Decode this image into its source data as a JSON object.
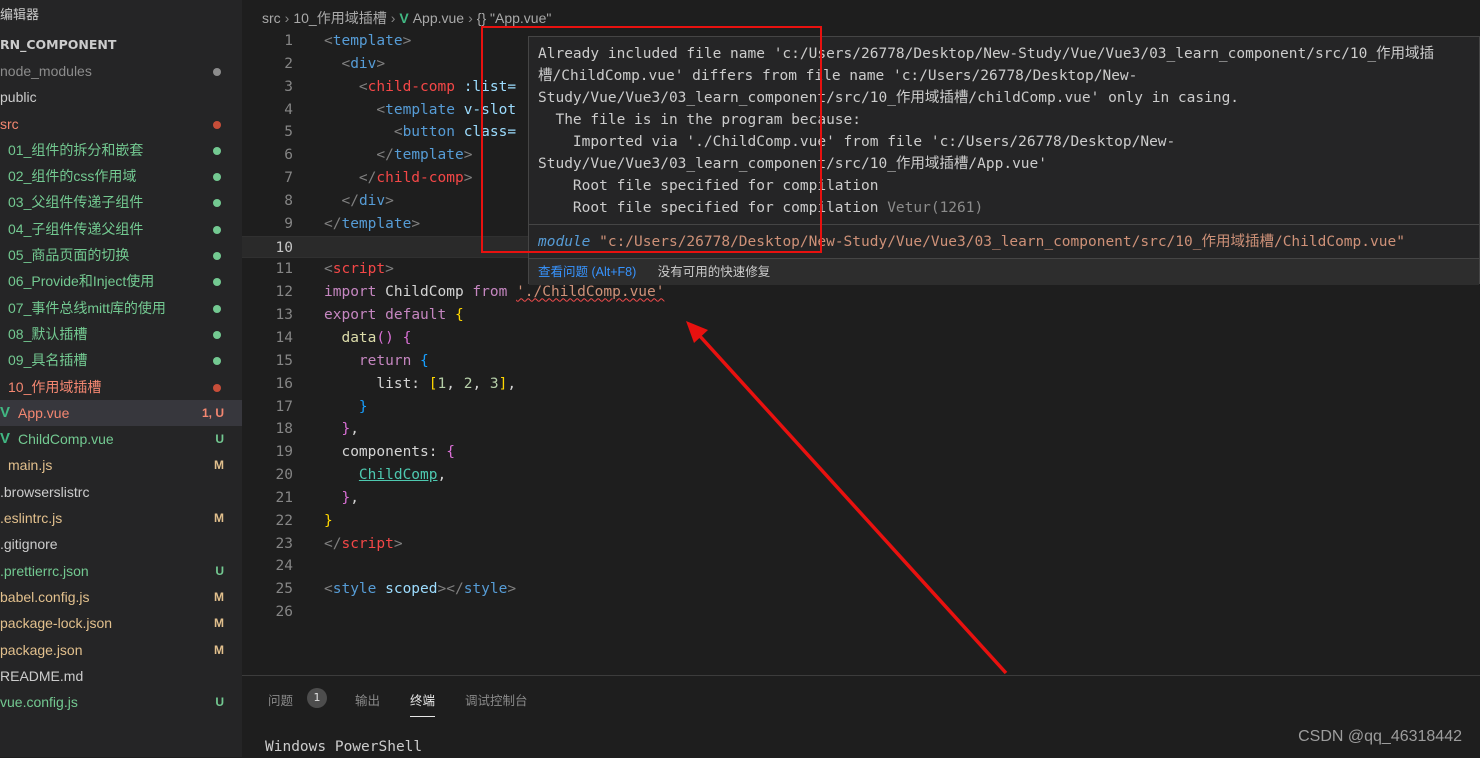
{
  "sidebar": {
    "title": "编辑器",
    "project": "RN_COMPONENT",
    "items": [
      {
        "label": "node_modules",
        "color": "gray",
        "dot": "gray"
      },
      {
        "label": "public",
        "color": "white"
      },
      {
        "label": "src",
        "color": "red",
        "dot": "red"
      },
      {
        "label": "01_组件的拆分和嵌套",
        "color": "green",
        "dot": "green"
      },
      {
        "label": "02_组件的css作用域",
        "color": "green",
        "dot": "green"
      },
      {
        "label": "03_父组件传递子组件",
        "color": "green",
        "dot": "green"
      },
      {
        "label": "04_子组件传递父组件",
        "color": "green",
        "dot": "green"
      },
      {
        "label": "05_商品页面的切换",
        "color": "green",
        "dot": "green"
      },
      {
        "label": "06_Provide和Inject使用",
        "color": "green",
        "dot": "green"
      },
      {
        "label": "07_事件总线mitt库的使用",
        "color": "green",
        "dot": "green"
      },
      {
        "label": "08_默认插槽",
        "color": "green",
        "dot": "green"
      },
      {
        "label": "09_具名插槽",
        "color": "green",
        "dot": "green"
      },
      {
        "label": "10_作用域插槽",
        "color": "red",
        "dot": "red"
      },
      {
        "label": "App.vue",
        "color": "red",
        "badge": "1, U",
        "icon": "vue-icon",
        "active": true
      },
      {
        "label": "ChildComp.vue",
        "color": "green",
        "badge": "U",
        "icon": "vue-icon"
      },
      {
        "label": "main.js",
        "color": "yellow",
        "badge": "M"
      },
      {
        "label": ".browserslistrc",
        "color": "white"
      },
      {
        "label": ".eslintrc.js",
        "color": "yellow",
        "badge": "M"
      },
      {
        "label": ".gitignore",
        "color": "white"
      },
      {
        "label": ".prettierrc.json",
        "color": "green",
        "badge": "U"
      },
      {
        "label": "babel.config.js",
        "color": "yellow",
        "badge": "M"
      },
      {
        "label": "package-lock.json",
        "color": "yellow",
        "badge": "M"
      },
      {
        "label": "package.json",
        "color": "yellow",
        "badge": "M"
      },
      {
        "label": "README.md",
        "color": "white"
      },
      {
        "label": "vue.config.js",
        "color": "green",
        "badge": "U"
      }
    ]
  },
  "breadcrumb": {
    "src": "src",
    "folder": "10_作用域插槽",
    "file": "App.vue",
    "symbol": "{} \"App.vue\""
  },
  "editor": {
    "current_line": 10,
    "lines": [
      [
        [
          "<",
          "t-br"
        ],
        [
          "template",
          "t-tag"
        ],
        [
          ">",
          "t-br"
        ]
      ],
      [
        [
          "  ",
          "t-pl"
        ],
        [
          "<",
          "t-br"
        ],
        [
          "div",
          "t-tag"
        ],
        [
          ">",
          "t-br"
        ]
      ],
      [
        [
          "    ",
          "t-pl"
        ],
        [
          "<",
          "t-br"
        ],
        [
          "child-comp",
          "t-tagred"
        ],
        [
          " :list=",
          "t-id"
        ]
      ],
      [
        [
          "      ",
          "t-pl"
        ],
        [
          "<",
          "t-br"
        ],
        [
          "template",
          "t-tag"
        ],
        [
          " v-slot",
          "t-id"
        ]
      ],
      [
        [
          "        ",
          "t-pl"
        ],
        [
          "<",
          "t-br"
        ],
        [
          "button",
          "t-tag"
        ],
        [
          " class=",
          "t-id"
        ]
      ],
      [
        [
          "      ",
          "t-pl"
        ],
        [
          "</",
          "t-br"
        ],
        [
          "template",
          "t-tag"
        ],
        [
          ">",
          "t-br"
        ]
      ],
      [
        [
          "    ",
          "t-pl"
        ],
        [
          "</",
          "t-br"
        ],
        [
          "child-comp",
          "t-tagred"
        ],
        [
          ">",
          "t-br"
        ]
      ],
      [
        [
          "  ",
          "t-pl"
        ],
        [
          "</",
          "t-br"
        ],
        [
          "div",
          "t-tag"
        ],
        [
          ">",
          "t-br"
        ]
      ],
      [
        [
          "</",
          "t-br"
        ],
        [
          "template",
          "t-tag"
        ],
        [
          ">",
          "t-br"
        ]
      ],
      [],
      [
        [
          "<",
          "t-br"
        ],
        [
          "script",
          "t-tagred"
        ],
        [
          ">",
          "t-br"
        ]
      ],
      [
        [
          "import",
          "t-kw"
        ],
        [
          " ChildComp ",
          "t-pl"
        ],
        [
          "from",
          "t-kw"
        ],
        [
          " ",
          "t-pl"
        ],
        [
          "'./ChildComp.vue'",
          "t-str squiggle"
        ]
      ],
      [
        [
          "export",
          "t-kw"
        ],
        [
          " ",
          "t-pl"
        ],
        [
          "default",
          "t-kw"
        ],
        [
          " ",
          "t-pl"
        ],
        [
          "{",
          "t-y"
        ]
      ],
      [
        [
          "  ",
          "t-pl"
        ],
        [
          "data",
          "t-fn"
        ],
        [
          "()",
          "t-m"
        ],
        [
          " ",
          "t-pl"
        ],
        [
          "{",
          "t-m"
        ]
      ],
      [
        [
          "    ",
          "t-pl"
        ],
        [
          "return",
          "t-kw"
        ],
        [
          " ",
          "t-pl"
        ],
        [
          "{",
          "t-cy"
        ]
      ],
      [
        [
          "      list: ",
          "t-pl"
        ],
        [
          "[",
          "t-y"
        ],
        [
          "1",
          "t-num"
        ],
        [
          ", ",
          "t-pl"
        ],
        [
          "2",
          "t-num"
        ],
        [
          ", ",
          "t-pl"
        ],
        [
          "3",
          "t-num"
        ],
        [
          "]",
          "t-y"
        ],
        [
          ",",
          "t-pl"
        ]
      ],
      [
        [
          "    ",
          "t-pl"
        ],
        [
          "}",
          "t-cy"
        ]
      ],
      [
        [
          "  ",
          "t-pl"
        ],
        [
          "}",
          "t-m"
        ],
        [
          ",",
          "t-pl"
        ]
      ],
      [
        [
          "  components: ",
          "t-pl"
        ],
        [
          "{",
          "t-m"
        ]
      ],
      [
        [
          "    ",
          "t-pl"
        ],
        [
          "ChildComp",
          "t-comp"
        ],
        [
          ",",
          "t-pl"
        ]
      ],
      [
        [
          "  ",
          "t-pl"
        ],
        [
          "}",
          "t-m"
        ],
        [
          ",",
          "t-pl"
        ]
      ],
      [
        [
          "}",
          "t-y"
        ]
      ],
      [
        [
          "</",
          "t-br"
        ],
        [
          "script",
          "t-tagred"
        ],
        [
          ">",
          "t-br"
        ]
      ],
      [],
      [
        [
          "<",
          "t-br"
        ],
        [
          "style",
          "t-tag"
        ],
        [
          " scoped",
          "t-id"
        ],
        [
          "></",
          "t-br"
        ],
        [
          "style",
          "t-tag"
        ],
        [
          ">",
          "t-br"
        ]
      ],
      []
    ]
  },
  "hover": {
    "message_lines": [
      "Already included file name 'c:/Users/26778/Desktop/New-Study/Vue/Vue3/03_learn_component/src/10_作用域插",
      "槽/ChildComp.vue' differs from file name 'c:/Users/26778/Desktop/New-",
      "Study/Vue/Vue3/03_learn_component/src/10_作用域插槽/childComp.vue' only in casing.",
      "  The file is in the program because:",
      "    Imported via './ChildComp.vue' from file 'c:/Users/26778/Desktop/New-",
      "Study/Vue/Vue3/03_learn_component/src/10_作用域插槽/App.vue'",
      "    Root file specified for compilation",
      "    Root file specified for compilation "
    ],
    "source": "Vetur(1261)",
    "module_keyword": "module",
    "module_path": " \"c:/Users/26778/Desktop/New-Study/Vue/Vue3/03_learn_component/src/10_作用域插槽/ChildComp.vue\"",
    "view_problem": "查看问题 (Alt+F8)",
    "no_fix": "没有可用的快速修复"
  },
  "panel": {
    "tabs": [
      "问题",
      "输出",
      "终端",
      "调试控制台"
    ],
    "active_tab": "终端",
    "problem_count": "1",
    "terminal_text": "Windows PowerShell",
    "watermark": "CSDN @qq_46318442"
  },
  "colors": {
    "annotation_red": "#e8110f",
    "vue_green": "#41b883"
  }
}
